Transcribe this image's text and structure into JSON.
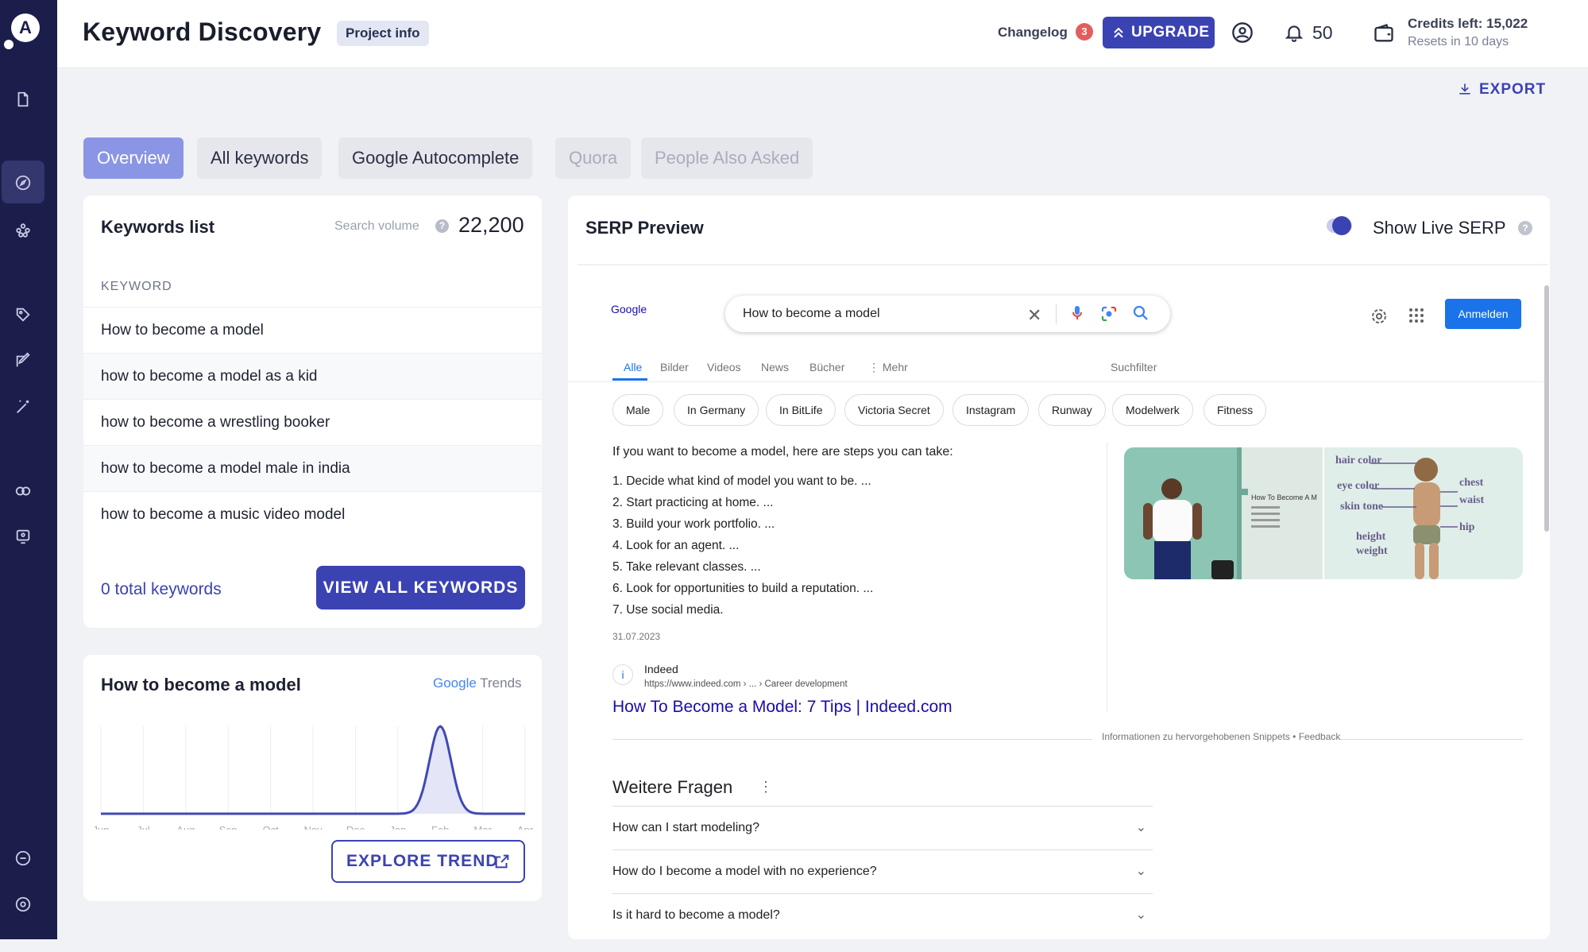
{
  "header": {
    "title": "Keyword Discovery",
    "project_info": "Project info",
    "changelog": "Changelog",
    "changelog_count": "3",
    "upgrade": "UPGRADE",
    "notifications": "50",
    "credits": "Credits left: 15,022",
    "resets": "Resets in 10 days",
    "export": "EXPORT"
  },
  "tabs": [
    "Overview",
    "All keywords",
    "Google Autocomplete",
    "Quora",
    "People Also Asked"
  ],
  "keywords_card": {
    "title": "Keywords list",
    "search_volume_label": "Search volume",
    "search_volume": "22,200",
    "column_header": "KEYWORD",
    "keywords": [
      "How to become a model",
      "how to become a model as a kid",
      "how to become a wrestling booker",
      "how to become a model male in india",
      "how to become a music video model"
    ],
    "total": "0 total keywords",
    "view_all": "VIEW ALL KEYWORDS"
  },
  "trend_card": {
    "title": "How to become a model",
    "brand_google": "Google",
    "brand_trends": "Trends",
    "months": [
      "Jun",
      "Jul",
      "Aug",
      "Sep",
      "Oct",
      "Nov",
      "Dec",
      "Jan",
      "Feb",
      "Mar",
      "Apr"
    ],
    "values": [
      0,
      0,
      0,
      0,
      0,
      0,
      0,
      0,
      100,
      0,
      0
    ],
    "explore": "EXPLORE TREND"
  },
  "serp": {
    "title": "SERP Preview",
    "live_label": "Show Live SERP",
    "live_on": true,
    "google": {
      "logo_alt": "Google",
      "query": "How to become a model",
      "sign_in": "Anmelden",
      "nav": [
        "Alle",
        "Bilder",
        "Videos",
        "News",
        "Bücher",
        "⋮ Mehr",
        "Suchfilter"
      ],
      "chips": [
        "Male",
        "In Germany",
        "In BitLife",
        "Victoria Secret",
        "Instagram",
        "Runway",
        "Modelwerk",
        "Fitness"
      ],
      "snippet_heading": "If you want to become a model, here are steps you can take:",
      "steps": [
        "1. Decide what kind of model you want to be. ...",
        "2. Start practicing at home. ...",
        "3. Build your work portfolio. ...",
        "4. Look for an agent. ...",
        "5. Take relevant classes. ...",
        "6. Look for opportunities to build a reputation. ...",
        "7. Use social media."
      ],
      "date": "31.07.2023",
      "source_name": "Indeed",
      "source_url": "https://www.indeed.com › ... › Career development",
      "link": "How To Become a Model: 7 Tips | Indeed.com",
      "info": "Informationen zu hervorgehobenen Snippets  •  Feedback",
      "img1_text": "How To Become A M",
      "img2_labels": [
        "hair color",
        "eye color",
        "skin tone",
        "height",
        "weight",
        "chest",
        "waist",
        "hip"
      ],
      "more_questions": "Weitere Fragen",
      "questions": [
        "How can I start modeling?",
        "How do I become a model with no experience?",
        "Is it hard to become a model?"
      ]
    }
  }
}
